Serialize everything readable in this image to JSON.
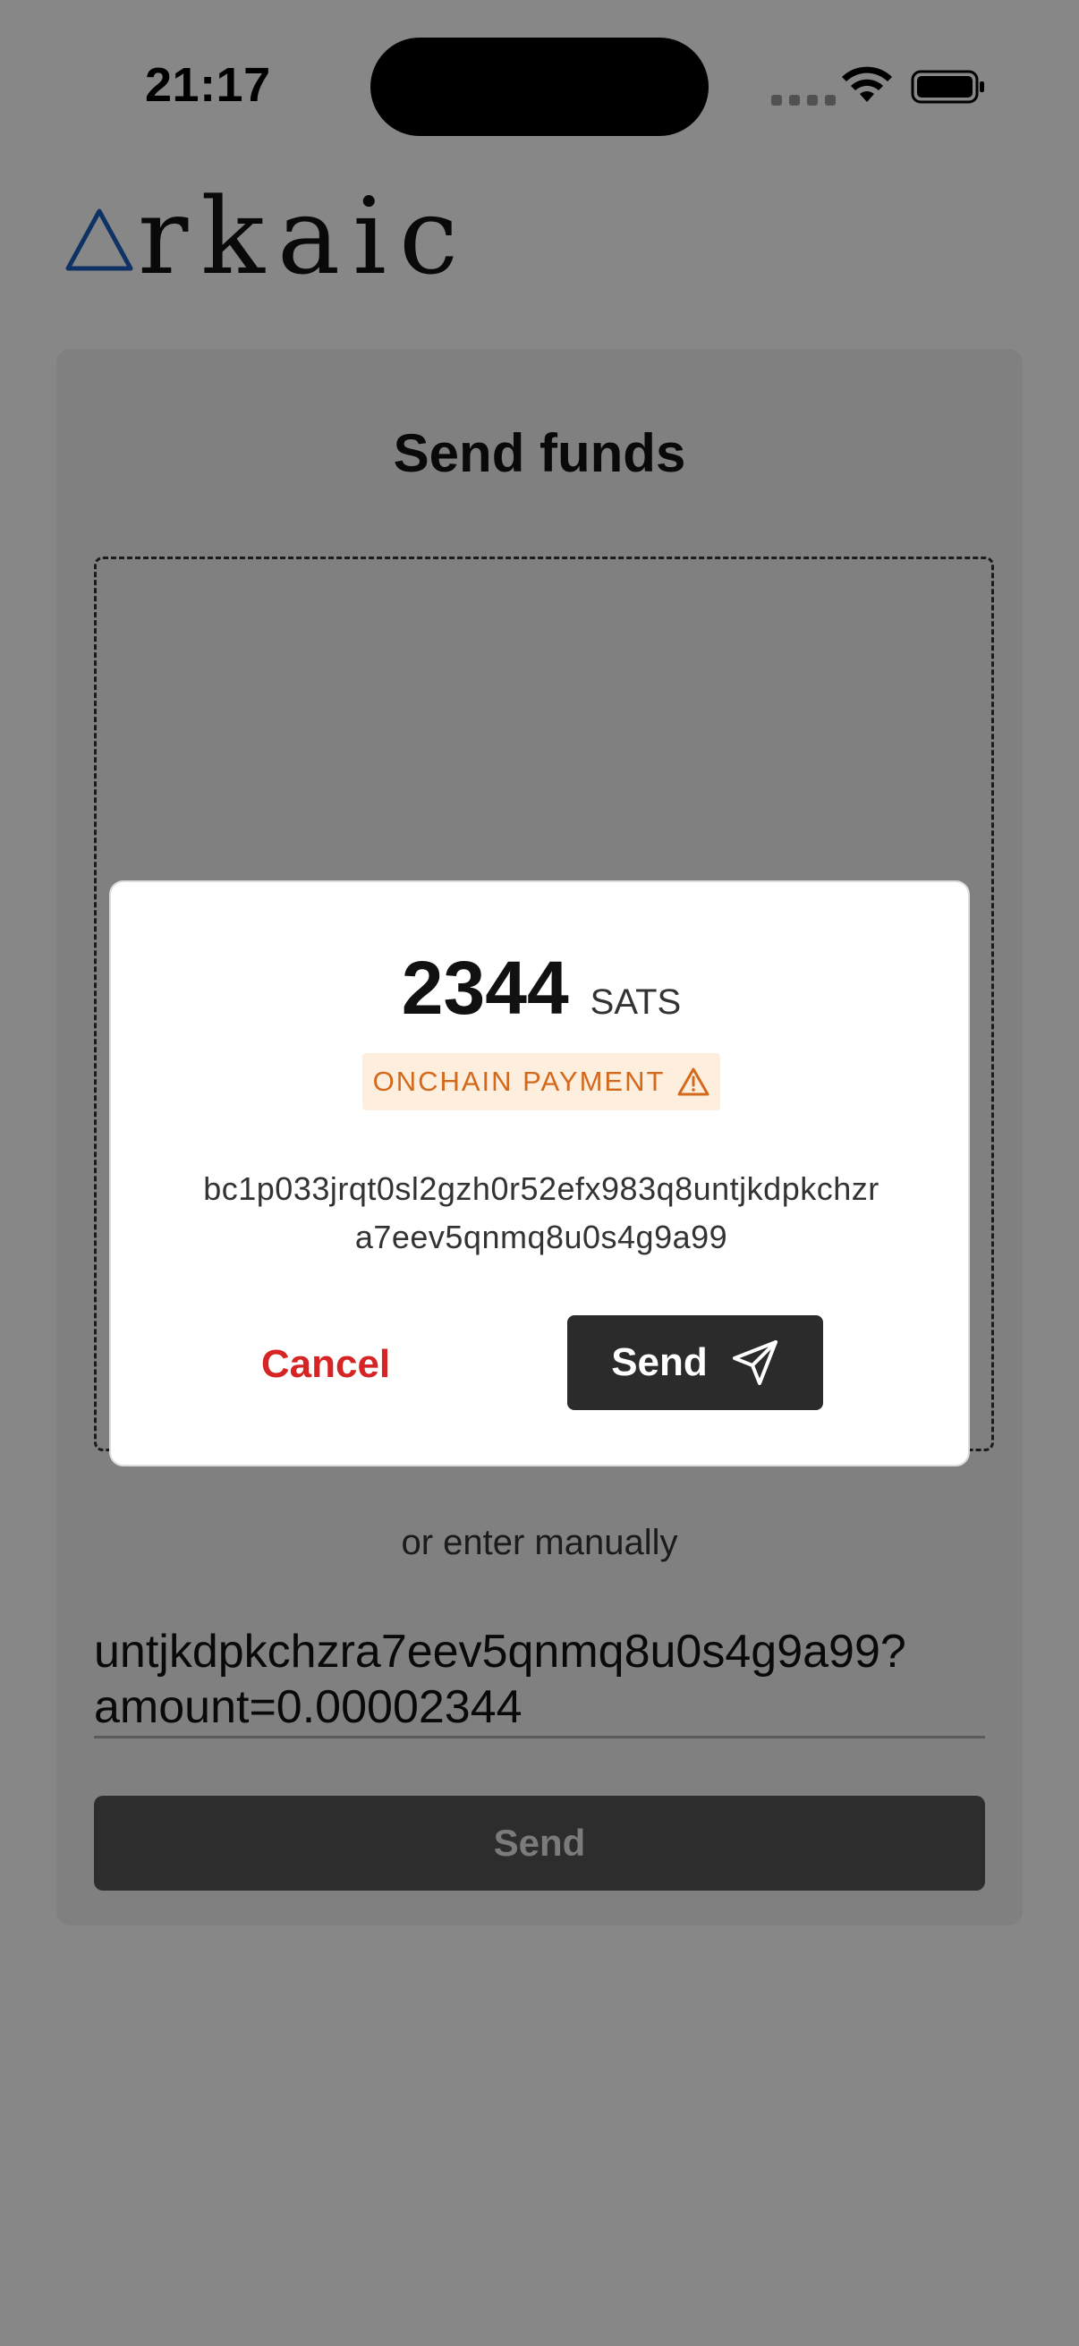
{
  "status_bar": {
    "time": "21:17"
  },
  "logo": {
    "text": "rkaic",
    "accent_color": "#1e5fbf"
  },
  "card": {
    "title": "Send funds",
    "manual_label": "or enter manually",
    "address_input_value": "untjkdpkchzra7eev5qnmq8u0s4g9a99?\namount=0.00002344",
    "send_label": "Send"
  },
  "modal": {
    "amount": "2344",
    "unit": "SATS",
    "badge_label": "ONCHAIN PAYMENT",
    "address_line1": "bc1p033jrqt0sl2gzh0r52efx983q8untjkdpkchzr",
    "address_line2": "a7eev5qnmq8u0s4g9a99",
    "cancel_label": "Cancel",
    "send_label": "Send"
  },
  "colors": {
    "cancel": "#d62424",
    "badge_text": "#d4691c",
    "badge_bg": "#fdeede",
    "send_button": "#2b2b2b"
  },
  "icons": [
    "wifi-icon",
    "battery-icon",
    "logo-triangle-icon",
    "warning-icon",
    "paper-plane-icon"
  ]
}
